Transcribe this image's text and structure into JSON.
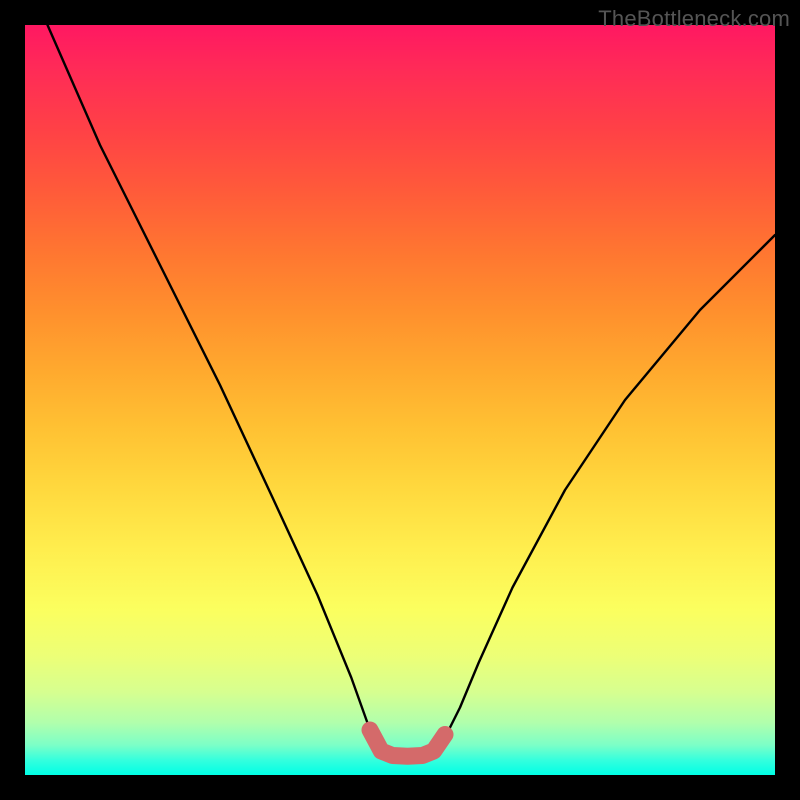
{
  "watermark": "TheBottleneck.com",
  "chart_data": {
    "type": "line",
    "title": "",
    "xlabel": "",
    "ylabel": "",
    "xlim": [
      0,
      100
    ],
    "ylim": [
      0,
      100
    ],
    "series": [
      {
        "name": "bottleneck-curve",
        "x": [
          3,
          10,
          18,
          26,
          33,
          39,
          43.5,
          46,
          48,
          50,
          52,
          54,
          56,
          58,
          60.5,
          65,
          72,
          80,
          90,
          100
        ],
        "values": [
          100,
          84,
          68,
          52,
          37,
          24,
          13,
          6,
          3,
          2.5,
          2.5,
          3,
          5,
          9,
          15,
          25,
          38,
          50,
          62,
          72
        ]
      }
    ],
    "accent_segment": {
      "name": "flat-bottom-highlight",
      "x": [
        46,
        47.5,
        49,
        51,
        53,
        54.5,
        56
      ],
      "values": [
        6,
        3.2,
        2.6,
        2.5,
        2.6,
        3.2,
        5.4
      ]
    },
    "gradient_stops": [
      {
        "pos": 0,
        "color": "#ff1862"
      },
      {
        "pos": 50,
        "color": "#ffc233"
      },
      {
        "pos": 80,
        "color": "#fbff5f"
      },
      {
        "pos": 100,
        "color": "#00ffe6"
      }
    ]
  }
}
